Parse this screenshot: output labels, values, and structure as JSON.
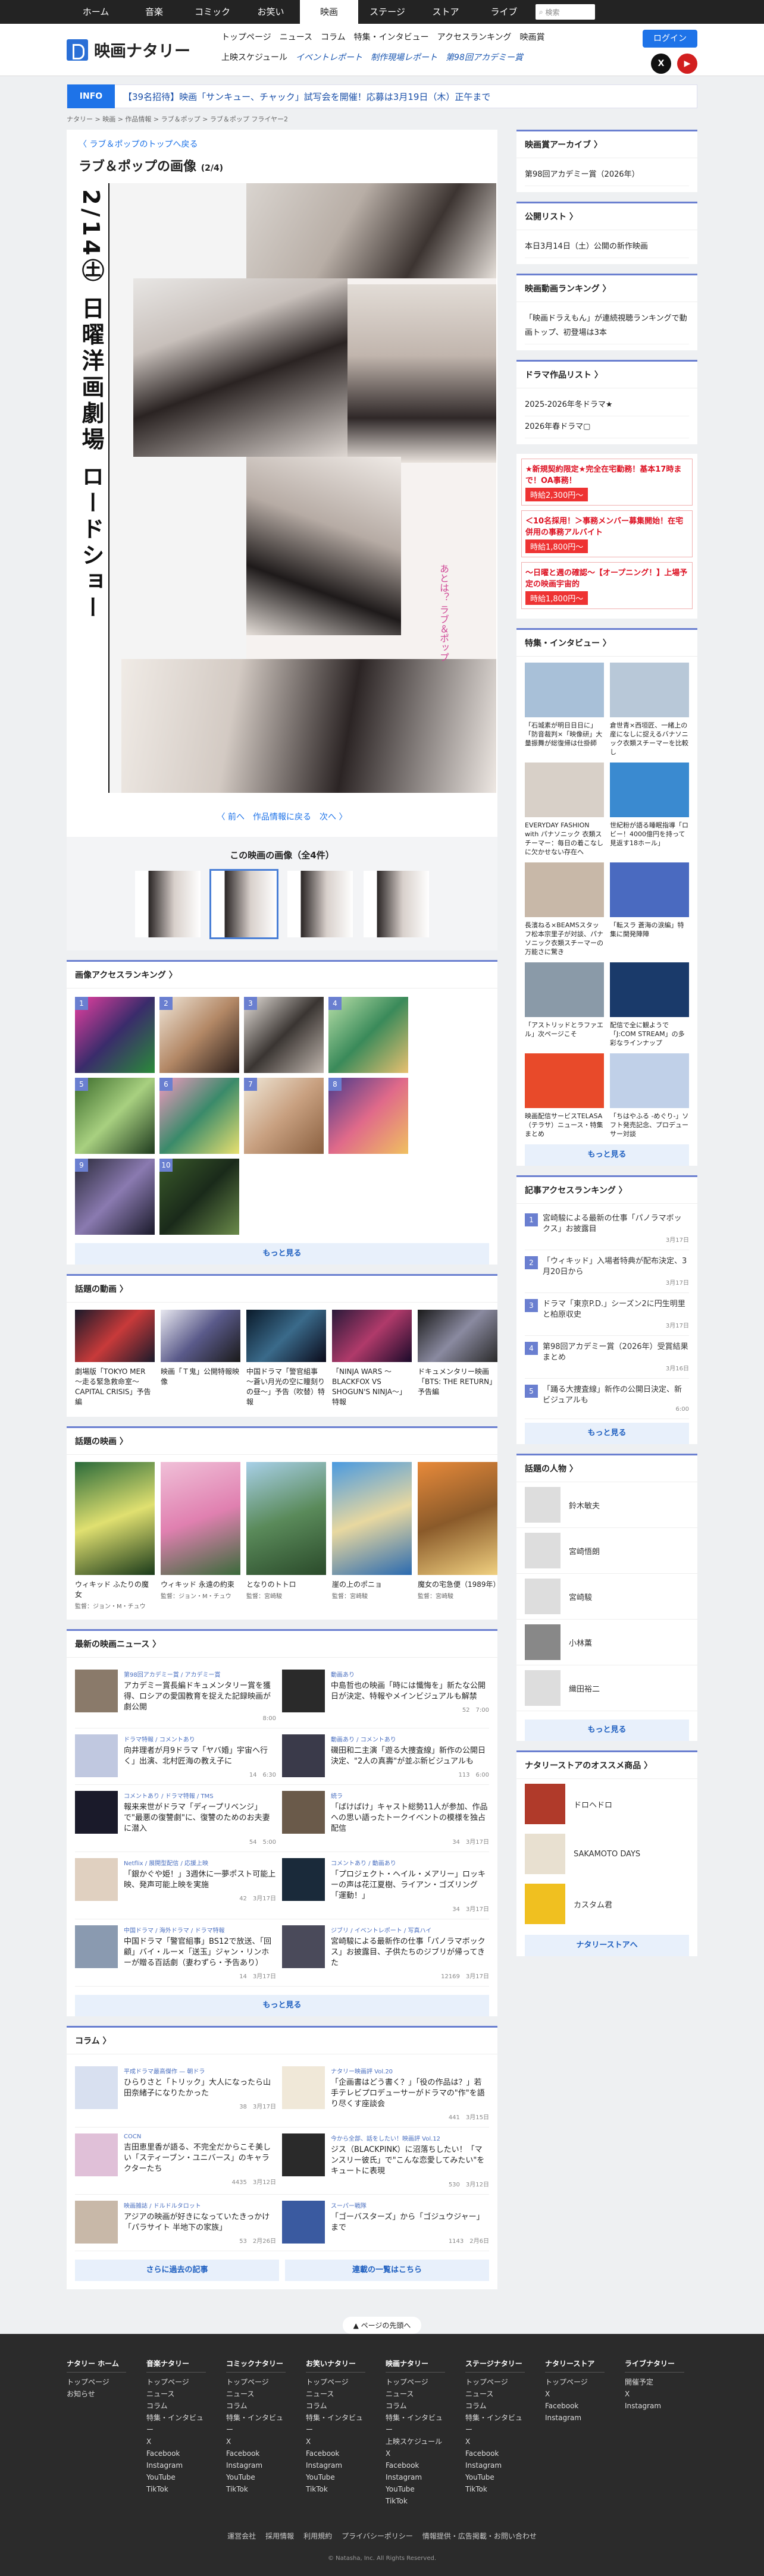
{
  "topnav": [
    "ホーム",
    "音楽",
    "コミック",
    "お笑い",
    "映画",
    "ステージ",
    "ストア",
    "ライブ"
  ],
  "search_placeholder": "検索",
  "logo": "映画ナタリー",
  "gnav1": [
    "トップページ",
    "ニュース",
    "コラム",
    "特集・インタビュー",
    "アクセスランキング",
    "映画賞"
  ],
  "gnav2": [
    "上映スケジュール",
    "イベントレポート",
    "制作現場レポート",
    "第98回アカデミー賞"
  ],
  "login": "ログイン",
  "info_label": "INFO",
  "info_text": "【39名招待】映画「サンキュー、チャック」試写会を開催！応募は3月19日（木）正午まで",
  "breadcrumb": "ナタリー > 映画 > 作品情報 > ラブ＆ポップ > ラブ＆ポップ フライヤー2",
  "back_link": "〈 ラブ＆ポップのトップへ戻る",
  "gallery_title": "ラブ＆ポップの画像",
  "gallery_count": "(2/4)",
  "poster_vtext": "2/14㊏ 日曜洋画劇場 ロードショー",
  "poster_pink": "あとは？ ラブ＆ポップ",
  "gallery_nav": "〈 前へ　作品情報に戻る　次へ 〉",
  "thumbs_title": "この映画の画像（全4件）",
  "ranking_title": "画像アクセスランキング 〉",
  "ranking": [
    "1",
    "2",
    "3",
    "4",
    "5",
    "6",
    "7",
    "8",
    "9",
    "10"
  ],
  "more": "もっと見る",
  "videos_title": "話題の動画 〉",
  "videos": [
    "劇場版「TOKYO MER 〜走る緊急救命室〜 CAPITAL CRISIS」予告編",
    "映画「Ｔ鬼」公開特報映像",
    "中国ドラマ「警官組事 〜蒼い月光の空に瞳刻りの昼〜」予告（吹替）特報",
    "「NINJA WARS 〜BLACKFOX VS SHOGUN'S NINJA〜」特報",
    "ドキュメンタリー映画「BTS: THE RETURN」予告編"
  ],
  "films_title": "話題の映画 〉",
  "films": [
    {
      "t": "ウィキッド ふたりの魔女",
      "s": "監督：ジョン・M・チュウ"
    },
    {
      "t": "ウィキッド 永遠の約束",
      "s": "監督：ジョン・M・チュウ"
    },
    {
      "t": "となりのトトロ",
      "s": "監督：宮崎駿"
    },
    {
      "t": "崖の上のポニョ",
      "s": "監督：宮崎駿"
    },
    {
      "t": "魔女の宅急便（1989年）",
      "s": "監督：宮崎駿"
    }
  ],
  "news_title": "最新の映画ニュース 〉",
  "news": [
    {
      "tag": "第98回アカデミー賞 / アカデミー賞",
      "t": "アカデミー賞長編ドキュメンタリー賞を獲得、ロシアの愛国教育を捉えた記録映画が劇公開",
      "m": "8:00"
    },
    {
      "tag": "動画あり",
      "t": "中島哲也の映画「時には懺悔を」新たな公開日が決定、特報やメインビジュアルも解禁",
      "m": "52　7:00"
    },
    {
      "tag": "ドラマ特報 / コメントあり",
      "t": "向井理者が月9ドラマ「ヤバ婚」宇宙へ行く」出演、北村匠海の教え子に",
      "m": "14　6:30"
    },
    {
      "tag": "動画あり / コメントあり",
      "t": "磯田和二主演「遊る大捜査線」新作の公開日決定、\"2人の真壽\"が並ぶ新ビジュアルも",
      "m": "113　6:00"
    },
    {
      "tag": "コメントあり / ドラマ特報 / TMS",
      "t": "報来来世がドラマ「ディープリベンジ」で\"最悪の復讐劇\"に、復讐のためのお夫妻に潜入",
      "m": "54　5:00"
    },
    {
      "tag": "続ラ",
      "t": "「ばけばけ」キャスト総勢11人が参加、作品への思い語ったトークイベントの模様を独占配信",
      "m": "34　3月17日"
    },
    {
      "tag": "Netflix / 展開型配信 / 応援上映",
      "t": "「銀かぐや姫！」3週休に一夢ポスト可能上映、発声可能上映を実施",
      "m": "42　3月17日"
    },
    {
      "tag": "コメントあり / 動画あり",
      "t": "「プロジェクト・ヘイル・メアリー」ロッキーの声は花江夏樹、ライアン・ゴズリング「運動！」",
      "m": "34　3月17日"
    },
    {
      "tag": "中国ドラマ / 海外ドラマ / ドラマ特報",
      "t": "中国ドラマ「警官組事」BS12で放送、「回顧」バイ・ルー×「送玉」ジャン・リンホーが贈る百話劇（妻わずら・予告あり）",
      "m": "14　3月17日"
    },
    {
      "tag": "ジブリ / イベントレポート / 写真ハイ",
      "t": "宮崎駿による最新作の仕事「パノラマボックス」お披露目、子供たちのジブリが帰ってきた",
      "m": "12169　3月17日"
    }
  ],
  "column_title": "コラム 〉",
  "columns": [
    {
      "tag": "平成ドラマ最高傑作 — 朝ドラ",
      "t": "ひらりさと「トリック」大人になったら山田奈緒子になりたかった",
      "m": "38　3月17日"
    },
    {
      "tag": "ナタリー映画評 Vol.20",
      "t": "「企画書はどう書く？」「役の作品は？」若手テレビプロデューサーがドラマの\"作\"を語り尽くす座談会",
      "m": "441　3月15日"
    },
    {
      "tag": "COCN",
      "t": "吉田恵里香が語る、不完全だからこそ美しい「スティーブン・ユニバース」のキャラクターたち",
      "m": "4435　3月12日"
    },
    {
      "tag": "今から全部、話をしたい！映画評 Vol.12",
      "t": "ジス（BLACKPINK）に沼落ちしたい！「マンスリー彼氏」で\"こんな恋愛してみたい\"をキュートに表現",
      "m": "530　3月12日"
    },
    {
      "tag": "映画雑誌 / ドルドルタロット",
      "t": "アジアの映画が好きになっていたきっかけ「パラサイト 半地下の家族」",
      "m": "53　2月26日"
    },
    {
      "tag": "スーパー戦隊",
      "t": "「ゴーバスターズ」から「ゴジュウジャー」まで",
      "m": "1143　2月6日"
    }
  ],
  "col_more_left": "さらに過去の記事",
  "col_more_right": "連載の一覧はこちら",
  "side": {
    "archive_title": "映画賞アーカイブ 〉",
    "archive_item": "第98回アカデミー賞（2026年）",
    "release_title": "公開リスト 〉",
    "release_item": "本日3月14日（土）公開の新作映画",
    "video_rank_title": "映画動画ランキング 〉",
    "video_rank_item": "「映画ドラえもん」が連続視聴ランキングで動画トップ、初登場は3本",
    "drama_title": "ドラマ作品リスト 〉",
    "drama_items": [
      "2025-2026年冬ドラマ★",
      "2026年春ドラマ▢"
    ],
    "ads": [
      {
        "a1": "★新規契約限定★完全在宅勤務！基本17時まで！OA事務！",
        "price": "時給2,300円〜"
      },
      {
        "a1": "＜10名採用！＞事務メンバー募集開始！在宅併用の事務アルバイト",
        "price": "時給1,800円〜"
      },
      {
        "a1": "〜日曜と週の確認〜【オープニング！】上場予定の映画宇宙的",
        "price": "時給1,800円〜"
      }
    ],
    "feature_title": "特集・インタビュー 〉",
    "features": [
      "「石城素が明日日日に」「防音裁判×「映像研」大量振舞が総復帰は仕掛師",
      "倉世青×西垣匠、一緒上の産になしに捉えるバナソニック衣類スチーマーを比較し",
      "EVERYDAY FASHION with パナソニック 衣類スチーマー：毎日の着こなしに欠かせない存在へ",
      "世紀粉が語る睡眠指導「ロビー！4000億円を持って見返す18ホール」",
      "長濱ねる×BEAMSスタッフ松本宗里子が対談、パナソニック衣類スチーマーの万能さに驚き",
      "「転スラ 蒼海の涙編」特集に開発陣陣",
      "「アストリッドとラファエル」次ページこそ",
      "配信で全に観ようで「J:COM STREAM」の多彩なラインナップ",
      "映画配信サービスTELASA（テラサ）ニュース・特集まとめ",
      "「ちはやふる -めぐり-」ソフト発売記念、プロデューサー対談"
    ],
    "feature_more": "もっと見る",
    "article_rank_title": "記事アクセスランキング 〉",
    "article_rank": [
      {
        "t": "宮崎駿による最新の仕事「パノラマボックス」お披露目",
        "d": "3月17日"
      },
      {
        "t": "「ウィキッド」入場者特典が配布決定、3月20日から",
        "d": "3月17日"
      },
      {
        "t": "ドラマ「東京P.D.」シーズン2に円生明里と柏原収史",
        "d": "3月17日"
      },
      {
        "t": "第98回アカデミー賞（2026年）受賞結果まとめ",
        "d": "3月16日"
      },
      {
        "t": "「踊る大捜査線」新作の公開日決定、新ビジュアルも",
        "d": "6:00"
      }
    ],
    "article_more": "もっと見る",
    "people_title": "話題の人物 〉",
    "people": [
      "鈴木敏夫",
      "宮崎悟朗",
      "宮崎駿",
      "小林薫",
      "織田裕二"
    ],
    "people_more": "もっと見る",
    "shop_title": "ナタリーストアのオススメ商品 〉",
    "shop": [
      "ドロヘドロ",
      "SAKAMOTO DAYS",
      "カスタム君"
    ],
    "shop_btn": "ナタリーストアへ"
  },
  "pagetop": "▲ ページの先頭へ",
  "footer_cols": [
    {
      "h": "ナタリー ホーム",
      "items": [
        "トップページ",
        "お知らせ"
      ]
    },
    {
      "h": "音楽ナタリー",
      "items": [
        "トップページ",
        "ニュース",
        "コラム",
        "特集・インタビュー",
        "X",
        "Facebook",
        "Instagram",
        "YouTube",
        "TikTok"
      ]
    },
    {
      "h": "コミックナタリー",
      "items": [
        "トップページ",
        "ニュース",
        "コラム",
        "特集・インタビュー",
        "X",
        "Facebook",
        "Instagram",
        "YouTube",
        "TikTok"
      ]
    },
    {
      "h": "お笑いナタリー",
      "items": [
        "トップページ",
        "ニュース",
        "コラム",
        "特集・インタビュー",
        "X",
        "Facebook",
        "Instagram",
        "YouTube",
        "TikTok"
      ]
    },
    {
      "h": "映画ナタリー",
      "items": [
        "トップページ",
        "ニュース",
        "コラム",
        "特集・インタビュー",
        "上映スケジュール",
        "X",
        "Facebook",
        "Instagram",
        "YouTube",
        "TikTok"
      ]
    },
    {
      "h": "ステージナタリー",
      "items": [
        "トップページ",
        "ニュース",
        "コラム",
        "特集・インタビュー",
        "X",
        "Facebook",
        "Instagram",
        "YouTube",
        "TikTok"
      ]
    },
    {
      "h": "ナタリーストア",
      "items": [
        "トップページ",
        "X",
        "Facebook",
        "Instagram"
      ]
    },
    {
      "h": "ライブナタリー",
      "items": [
        "開催予定",
        "X",
        "Instagram"
      ]
    }
  ],
  "footer_links": [
    "運営会社",
    "採用情報",
    "利用規約",
    "プライバシーポリシー",
    "情報提供・広告掲載・お問い合わせ"
  ],
  "copyright": "© Natasha, Inc. All Rights Reserved."
}
